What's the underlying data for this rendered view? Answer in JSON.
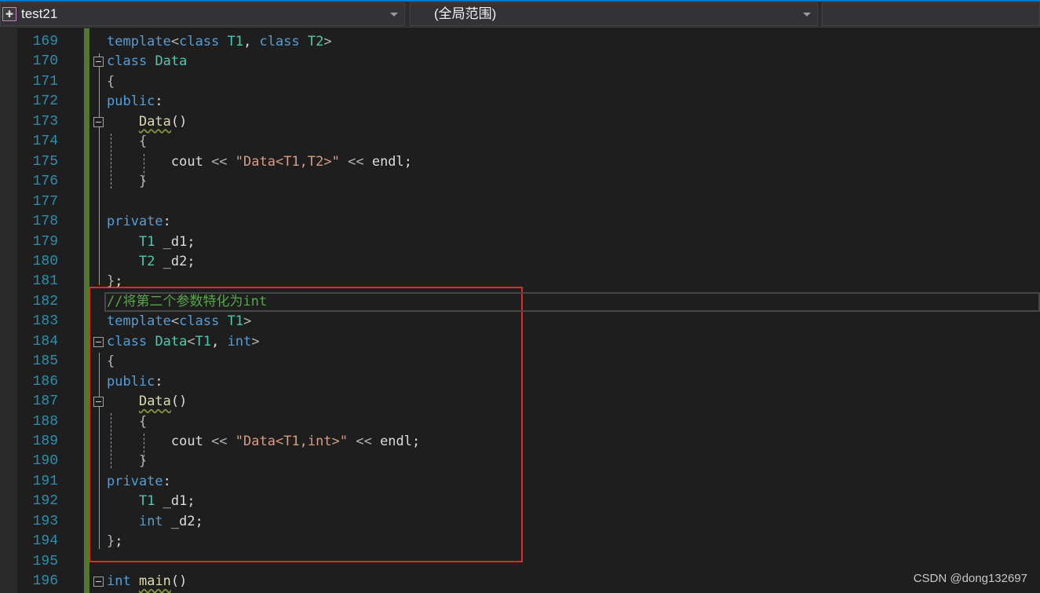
{
  "navbar": {
    "project": "test21",
    "scope": "(全局范围)",
    "member": ""
  },
  "colors": {
    "keyword": "#569cd6",
    "type": "#4ec9b0",
    "string": "#d69d85",
    "function": "#dcdcaa",
    "comment": "#57a64a",
    "line_number": "#2b91af",
    "highlight_box": "#e8262b"
  },
  "editor": {
    "current_line": 182,
    "lines": [
      {
        "n": "169",
        "fold": false,
        "tokens": [
          [
            "template",
            "k"
          ],
          [
            "<",
            "b"
          ],
          [
            "class",
            "k"
          ],
          [
            " ",
            "p"
          ],
          [
            "T1",
            "t"
          ],
          [
            ", ",
            "p"
          ],
          [
            "class",
            "k"
          ],
          [
            " ",
            "p"
          ],
          [
            "T2",
            "t"
          ],
          [
            ">",
            "b"
          ]
        ]
      },
      {
        "n": "170",
        "fold": true,
        "tokens": [
          [
            "class",
            "k"
          ],
          [
            " ",
            "p"
          ],
          [
            "Data",
            "t"
          ]
        ]
      },
      {
        "n": "171",
        "fold": false,
        "tokens": [
          [
            "{",
            "b"
          ]
        ]
      },
      {
        "n": "172",
        "fold": false,
        "tokens": [
          [
            "public",
            "k"
          ],
          [
            ":",
            "p"
          ]
        ]
      },
      {
        "n": "173",
        "fold": true,
        "tokens": [
          [
            "    ",
            "p"
          ],
          [
            "Data",
            "f"
          ],
          [
            "()",
            "p"
          ]
        ]
      },
      {
        "n": "174",
        "fold": false,
        "tokens": [
          [
            "    ",
            "p"
          ],
          [
            "{",
            "b"
          ]
        ]
      },
      {
        "n": "175",
        "fold": false,
        "tokens": [
          [
            "        cout ",
            "p"
          ],
          [
            "<<",
            "b"
          ],
          [
            " ",
            "p"
          ],
          [
            "\"Data<T1,T2>\"",
            "s"
          ],
          [
            " ",
            "p"
          ],
          [
            "<<",
            "b"
          ],
          [
            " endl;",
            "p"
          ]
        ]
      },
      {
        "n": "176",
        "fold": false,
        "tokens": [
          [
            "    ",
            "p"
          ],
          [
            "}",
            "b"
          ]
        ]
      },
      {
        "n": "177",
        "fold": false,
        "tokens": []
      },
      {
        "n": "178",
        "fold": false,
        "tokens": [
          [
            "private",
            "k"
          ],
          [
            ":",
            "p"
          ]
        ]
      },
      {
        "n": "179",
        "fold": false,
        "tokens": [
          [
            "    ",
            "p"
          ],
          [
            "T1",
            "t"
          ],
          [
            " _d1;",
            "p"
          ]
        ]
      },
      {
        "n": "180",
        "fold": false,
        "tokens": [
          [
            "    ",
            "p"
          ],
          [
            "T2",
            "t"
          ],
          [
            " _d2;",
            "p"
          ]
        ]
      },
      {
        "n": "181",
        "fold": false,
        "tokens": [
          [
            "}",
            "b"
          ],
          [
            ";",
            "p"
          ]
        ]
      },
      {
        "n": "182",
        "fold": false,
        "tokens": [
          [
            "//将第二个参数特化为int",
            "c"
          ]
        ]
      },
      {
        "n": "183",
        "fold": false,
        "tokens": [
          [
            "template",
            "k"
          ],
          [
            "<",
            "b"
          ],
          [
            "class",
            "k"
          ],
          [
            " ",
            "p"
          ],
          [
            "T1",
            "t"
          ],
          [
            ">",
            "b"
          ]
        ]
      },
      {
        "n": "184",
        "fold": true,
        "tokens": [
          [
            "class",
            "k"
          ],
          [
            " ",
            "p"
          ],
          [
            "Data",
            "t"
          ],
          [
            "<",
            "b"
          ],
          [
            "T1",
            "t"
          ],
          [
            ", ",
            "p"
          ],
          [
            "int",
            "k"
          ],
          [
            ">",
            "b"
          ]
        ]
      },
      {
        "n": "185",
        "fold": false,
        "tokens": [
          [
            "{",
            "b"
          ]
        ]
      },
      {
        "n": "186",
        "fold": false,
        "tokens": [
          [
            "public",
            "k"
          ],
          [
            ":",
            "p"
          ]
        ]
      },
      {
        "n": "187",
        "fold": true,
        "tokens": [
          [
            "    ",
            "p"
          ],
          [
            "Data",
            "f"
          ],
          [
            "()",
            "p"
          ]
        ]
      },
      {
        "n": "188",
        "fold": false,
        "tokens": [
          [
            "    ",
            "p"
          ],
          [
            "{",
            "b"
          ]
        ]
      },
      {
        "n": "189",
        "fold": false,
        "tokens": [
          [
            "        cout ",
            "p"
          ],
          [
            "<<",
            "b"
          ],
          [
            " ",
            "p"
          ],
          [
            "\"Data<T1,int>\"",
            "s"
          ],
          [
            " ",
            "p"
          ],
          [
            "<<",
            "b"
          ],
          [
            " endl;",
            "p"
          ]
        ]
      },
      {
        "n": "190",
        "fold": false,
        "tokens": [
          [
            "    ",
            "p"
          ],
          [
            "}",
            "b"
          ]
        ]
      },
      {
        "n": "191",
        "fold": false,
        "tokens": [
          [
            "private",
            "k"
          ],
          [
            ":",
            "p"
          ]
        ]
      },
      {
        "n": "192",
        "fold": false,
        "tokens": [
          [
            "    ",
            "p"
          ],
          [
            "T1",
            "t"
          ],
          [
            " _d1;",
            "p"
          ]
        ]
      },
      {
        "n": "193",
        "fold": false,
        "tokens": [
          [
            "    ",
            "p"
          ],
          [
            "int",
            "k"
          ],
          [
            " _d2;",
            "p"
          ]
        ]
      },
      {
        "n": "194",
        "fold": false,
        "tokens": [
          [
            "}",
            "b"
          ],
          [
            ";",
            "p"
          ]
        ]
      },
      {
        "n": "195",
        "fold": false,
        "tokens": []
      },
      {
        "n": "196",
        "fold": true,
        "tokens": [
          [
            "int",
            "k"
          ],
          [
            " ",
            "p"
          ],
          [
            "main",
            "f"
          ],
          [
            "()",
            "p"
          ]
        ]
      }
    ]
  },
  "watermark": "CSDN @dong132697"
}
